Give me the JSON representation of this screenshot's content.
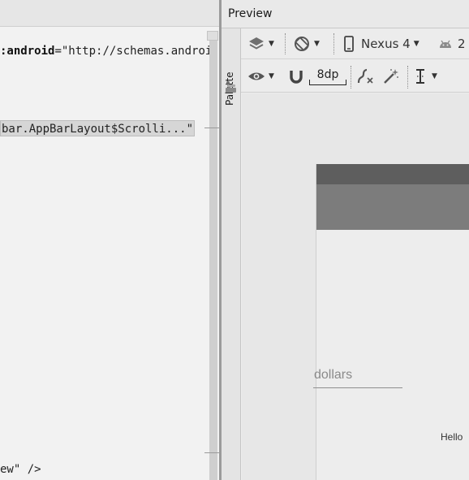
{
  "editor": {
    "lines": [
      {
        "parts": [
          {
            "t": ":android",
            "c": "kw"
          },
          {
            "t": "=\"http://schemas.androi",
            "c": "str"
          }
        ]
      },
      {
        "parts": [
          {
            "t": "bar.AppBarLayout$Scrolli...\"",
            "c": "str"
          }
        ]
      },
      {
        "parts": [
          {
            "t": "ew\" />",
            "c": "str"
          }
        ]
      }
    ]
  },
  "preview": {
    "title": "Preview",
    "palette_label": "Palette",
    "toolbar1": {
      "device": "Nexus 4",
      "api_level": "2"
    },
    "toolbar2": {
      "margin": "8dp"
    }
  },
  "canvas": {
    "edittext_hint": "dollars",
    "textview_text": "Hello"
  },
  "colors": {
    "status_bar": "#5e5e5e",
    "app_bar": "#7c7c7c",
    "canvas_bg": "#e7e7e7"
  },
  "icons": {
    "toolbar1": [
      "layers-icon",
      "rotate-orientation-icon",
      "phone-icon",
      "android-icon"
    ],
    "toolbar2": [
      "eye-icon",
      "magnet-icon",
      "constraint-path-icon",
      "magic-wand-icon",
      "align-vertical-icon"
    ]
  }
}
